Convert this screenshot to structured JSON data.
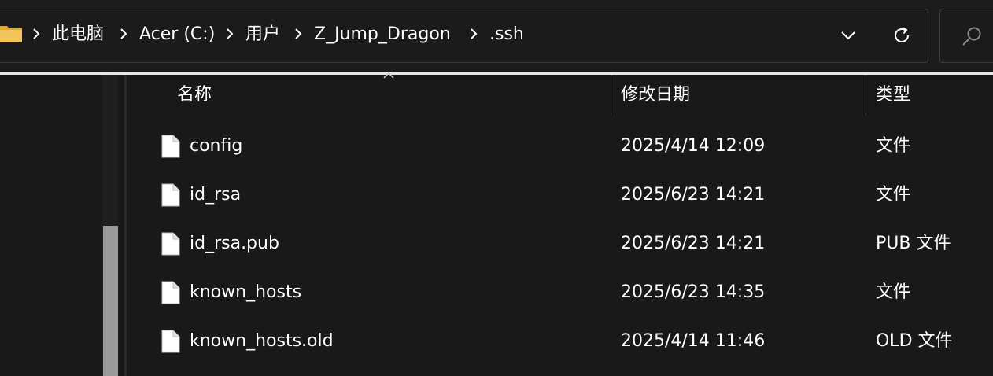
{
  "breadcrumb": {
    "items": [
      {
        "label": "此电脑"
      },
      {
        "label": "Acer (C:)"
      },
      {
        "label": "用户"
      },
      {
        "label": "Z_Jump_Dragon"
      },
      {
        "label": ".ssh"
      }
    ]
  },
  "icons": {
    "folder": "folder-icon",
    "separator": "chevron-right-icon",
    "dropdown": "chevron-down-icon",
    "refresh": "refresh-icon",
    "search": "search-icon",
    "file": "file-icon"
  },
  "colors": {
    "background": "#191919",
    "folder": "#f2c55c",
    "text": "#ffffff"
  },
  "file_list": {
    "columns": {
      "name": "名称",
      "date": "修改日期",
      "type": "类型"
    },
    "rows": [
      {
        "name": "config",
        "date": "2025/4/14 12:09",
        "type": "文件"
      },
      {
        "name": "id_rsa",
        "date": "2025/6/23 14:21",
        "type": "文件"
      },
      {
        "name": "id_rsa.pub",
        "date": "2025/6/23 14:21",
        "type": "PUB 文件"
      },
      {
        "name": "known_hosts",
        "date": "2025/6/23 14:35",
        "type": "文件"
      },
      {
        "name": "known_hosts.old",
        "date": "2025/4/14 11:46",
        "type": "OLD 文件"
      }
    ]
  }
}
